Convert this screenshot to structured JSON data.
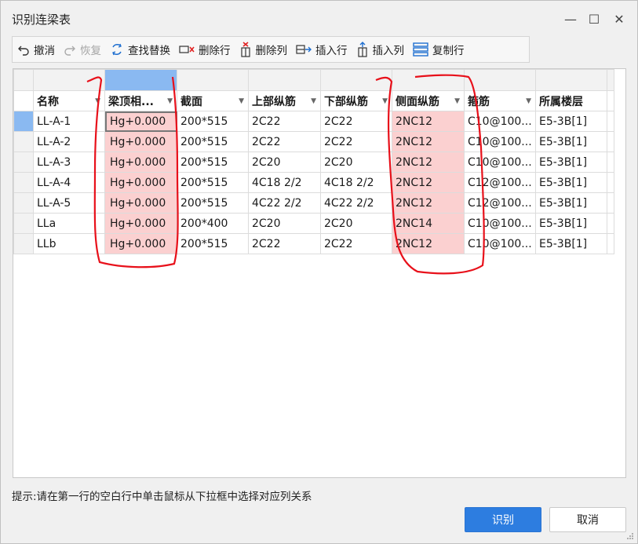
{
  "window": {
    "title": "识别连梁表",
    "minimize_glyph": "—",
    "maximize_glyph": "☐",
    "close_glyph": "✕"
  },
  "toolbar": {
    "undo": "撤消",
    "redo": "恢复",
    "find_replace": "查找替换",
    "delete_row": "删除行",
    "delete_col": "删除列",
    "insert_row": "插入行",
    "insert_col": "插入列",
    "copy_row": "复制行"
  },
  "table": {
    "headers": [
      "名称",
      "梁顶相...",
      "截面",
      "上部纵筋",
      "下部纵筋",
      "侧面纵筋",
      "箍筋",
      "所属楼层"
    ],
    "rows": [
      [
        "LL-A-1",
        "Hg+0.000",
        "200*515",
        "2C22",
        "2C22",
        "2NC12",
        "C10@100...",
        "E5-3B[1]"
      ],
      [
        "LL-A-2",
        "Hg+0.000",
        "200*515",
        "2C22",
        "2C22",
        "2NC12",
        "C10@100...",
        "E5-3B[1]"
      ],
      [
        "LL-A-3",
        "Hg+0.000",
        "200*515",
        "2C20",
        "2C20",
        "2NC12",
        "C10@100...",
        "E5-3B[1]"
      ],
      [
        "LL-A-4",
        "Hg+0.000",
        "200*515",
        "4C18 2/2",
        "4C18 2/2",
        "2NC12",
        "C12@100...",
        "E5-3B[1]"
      ],
      [
        "LL-A-5",
        "Hg+0.000",
        "200*515",
        "4C22 2/2",
        "4C22 2/2",
        "2NC12",
        "C12@100...",
        "E5-3B[1]"
      ],
      [
        "LLa",
        "Hg+0.000",
        "200*400",
        "2C20",
        "2C20",
        "2NC14",
        "C10@100...",
        "E5-3B[1]"
      ],
      [
        "LLb",
        "Hg+0.000",
        "200*515",
        "2C22",
        "2C22",
        "2NC12",
        "C10@100...",
        "E5-3B[1]"
      ]
    ]
  },
  "hint": "提示:请在第一行的空白行中单击鼠标从下拉框中选择对应列关系",
  "buttons": {
    "ok": "识别",
    "cancel": "取消"
  },
  "colors": {
    "highlight_pink": "#fbd0d0",
    "selected_blue": "#8ab9f1",
    "primary_button": "#2d7de0",
    "annotation_red": "#e8101a"
  }
}
